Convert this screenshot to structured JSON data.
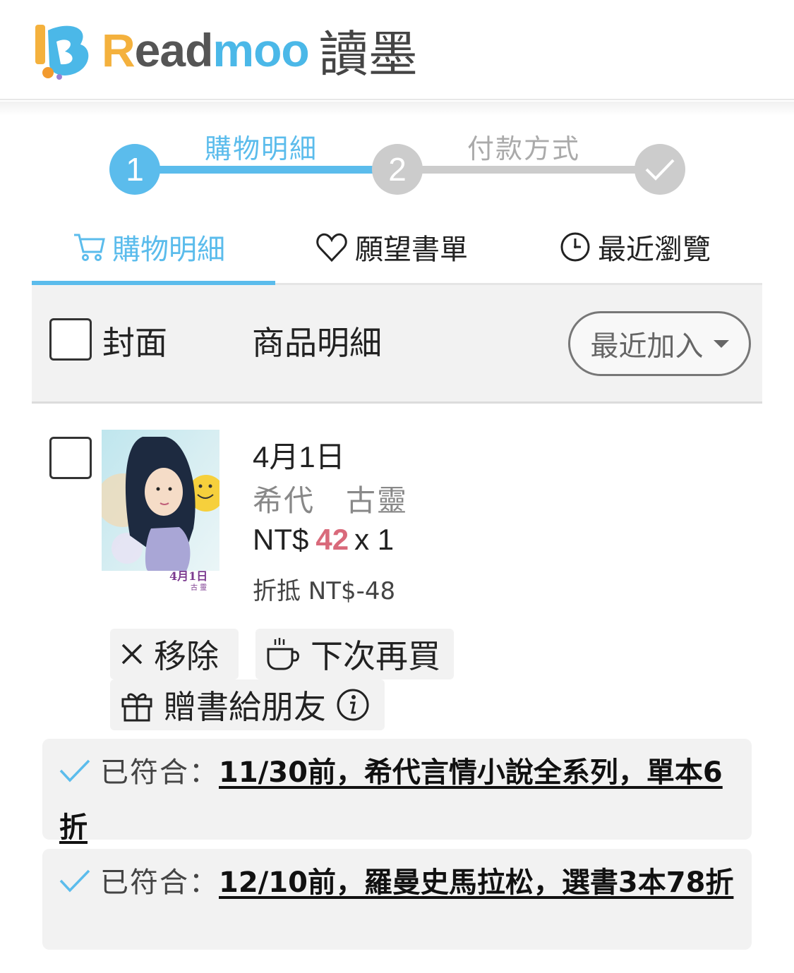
{
  "brand": {
    "name": "Readmoo",
    "name_parts": [
      "R",
      "ead",
      "moo"
    ],
    "chinese_name": "讀墨",
    "colors": {
      "orange": "#f4b13d",
      "grey": "#555555",
      "blue": "#4bb8e8"
    }
  },
  "stepper": {
    "steps": [
      {
        "number": "1",
        "label": "購物明細",
        "state": "active"
      },
      {
        "number": "2",
        "label": "付款方式",
        "state": "pending"
      },
      {
        "number": "",
        "label": "",
        "state": "pending",
        "icon": "check-icon"
      }
    ],
    "active_color": "#5bbcec",
    "inactive_color": "#cccccc"
  },
  "tabs": [
    {
      "label": "購物明細",
      "icon": "cart-icon",
      "active": true
    },
    {
      "label": "願望書單",
      "icon": "heart-icon",
      "active": false
    },
    {
      "label": "最近瀏覽",
      "icon": "clock-icon",
      "active": false
    }
  ],
  "table_header": {
    "cover_label": "封面",
    "detail_label": "商品明細",
    "sort_label": "最近加入"
  },
  "item": {
    "title": "4月1日",
    "author": "希代　古靈",
    "price_prefix": "NT$",
    "price": "42",
    "quantity_text": "x 1",
    "discount_text": "折抵 NT$-48",
    "cover_title": "4月1日",
    "cover_author": "古 靈",
    "actions": {
      "remove": "移除",
      "buy_later": "下次再買",
      "gift": "贈書給朋友"
    }
  },
  "promotions": [
    {
      "status_label": "已符合：",
      "text": "11/30前，希代言情小說全系列，單本6折"
    },
    {
      "status_label": "已符合：",
      "text": "12/10前，羅曼史馬拉松，選書3本78折"
    }
  ]
}
